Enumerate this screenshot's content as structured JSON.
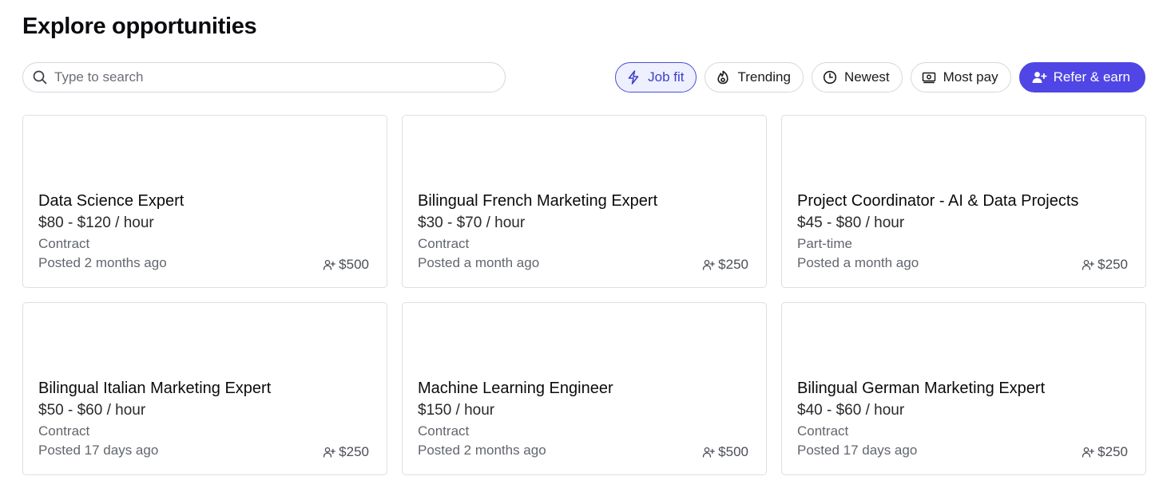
{
  "page": {
    "title": "Explore opportunities"
  },
  "search": {
    "placeholder": "Type to search",
    "icon": "search-icon"
  },
  "filters": [
    {
      "label": "Job fit",
      "icon": "lightning-icon",
      "state": "active"
    },
    {
      "label": "Trending",
      "icon": "flame-icon",
      "state": "default"
    },
    {
      "label": "Newest",
      "icon": "clock-icon",
      "state": "default"
    },
    {
      "label": "Most pay",
      "icon": "cash-icon",
      "state": "default"
    },
    {
      "label": "Refer & earn",
      "icon": "user-plus-icon",
      "state": "primary"
    }
  ],
  "colors": {
    "accent": "#4f46e5",
    "active_chip_bg": "#eef0ff",
    "active_chip_text": "#3e3fc8",
    "muted_text": "#62666d",
    "border": "#dcdfe4"
  },
  "jobs": [
    {
      "title": "Data Science Expert",
      "pay": "$80 - $120 / hour",
      "type": "Contract",
      "posted": "Posted 2 months ago",
      "referral_bonus": "$500"
    },
    {
      "title": "Bilingual French Marketing Expert",
      "pay": "$30 - $70 / hour",
      "type": "Contract",
      "posted": "Posted a month ago",
      "referral_bonus": "$250"
    },
    {
      "title": "Project Coordinator - AI & Data Projects",
      "pay": "$45 - $80 / hour",
      "type": "Part-time",
      "posted": "Posted a month ago",
      "referral_bonus": "$250"
    },
    {
      "title": "Bilingual Italian Marketing Expert",
      "pay": "$50 - $60 / hour",
      "type": "Contract",
      "posted": "Posted 17 days ago",
      "referral_bonus": "$250"
    },
    {
      "title": "Machine Learning Engineer",
      "pay": "$150 / hour",
      "type": "Contract",
      "posted": "Posted 2 months ago",
      "referral_bonus": "$500"
    },
    {
      "title": "Bilingual German Marketing Expert",
      "pay": "$40 - $60 / hour",
      "type": "Contract",
      "posted": "Posted 17 days ago",
      "referral_bonus": "$250"
    }
  ]
}
